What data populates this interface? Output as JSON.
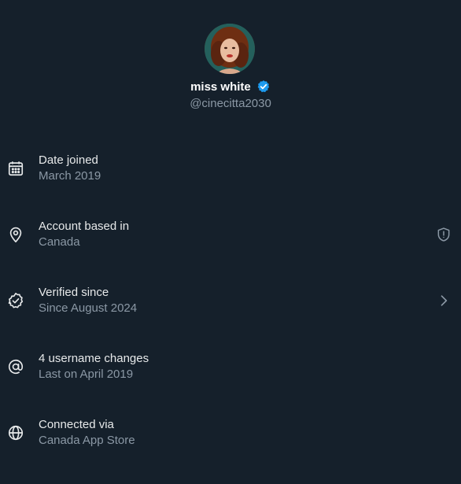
{
  "profile": {
    "name": "miss white",
    "handle": "@cinecitta2030"
  },
  "rows": [
    {
      "icon": "calendar-icon",
      "title": "Date joined",
      "subtitle": "March 2019",
      "trailing": ""
    },
    {
      "icon": "location-pin-icon",
      "title": "Account based in",
      "subtitle": "Canada",
      "trailing": "shield-alert-icon"
    },
    {
      "icon": "verified-check-icon",
      "title": "Verified since",
      "subtitle": "Since August 2024",
      "trailing": "chevron-right-icon"
    },
    {
      "icon": "at-sign-icon",
      "title": "4 username changes",
      "subtitle": "Last on April 2019",
      "trailing": ""
    },
    {
      "icon": "globe-icon",
      "title": "Connected via",
      "subtitle": "Canada App Store",
      "trailing": ""
    }
  ],
  "colors": {
    "background": "#15202b",
    "primary_text": "#e7e9ea",
    "secondary_text": "#8b98a5",
    "verified_blue": "#1d9bf0"
  }
}
